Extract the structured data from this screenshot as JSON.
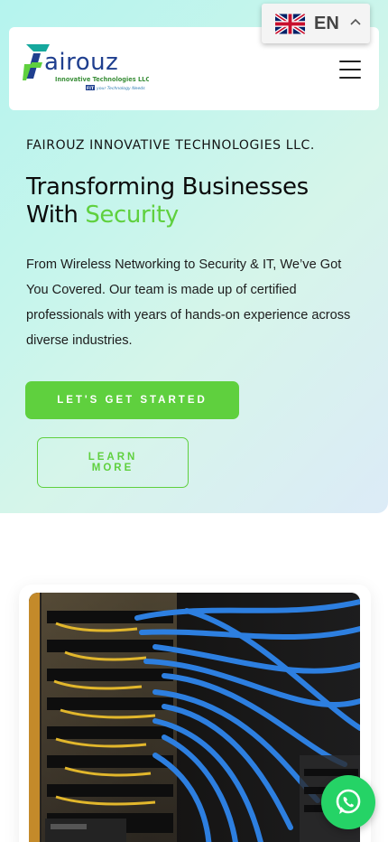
{
  "language": {
    "code": "EN",
    "flag_icon": "uk-flag-icon",
    "caret_icon": "chevron-up-icon"
  },
  "header": {
    "logo": {
      "main": "Fairouz",
      "sub": "Innovative Technologies LLC",
      "tagline_prefix": "FIT",
      "tagline": "your Technology Needs"
    },
    "menu_icon": "hamburger-menu-icon"
  },
  "hero": {
    "company": "FAIROUZ INNOVATIVE TECHNOLOGIES LLC.",
    "headline_line1": "Transforming Businesses",
    "headline_line2_prefix": "With ",
    "headline_accent": "Security",
    "description": "From Wireless Networking to Security & IT, We’ve Got You Covered. Our team is made up of certified professionals with years of hands-on experience across diverse industries.",
    "primary_button": "LET'S GET STARTED",
    "secondary_button": "LEARN MORE"
  },
  "floating": {
    "whatsapp_icon": "whatsapp-icon"
  },
  "colors": {
    "accent": "#5fd03e",
    "logo_teal": "#15a89d",
    "logo_blue": "#1f3f8f",
    "whatsapp": "#25d366"
  }
}
